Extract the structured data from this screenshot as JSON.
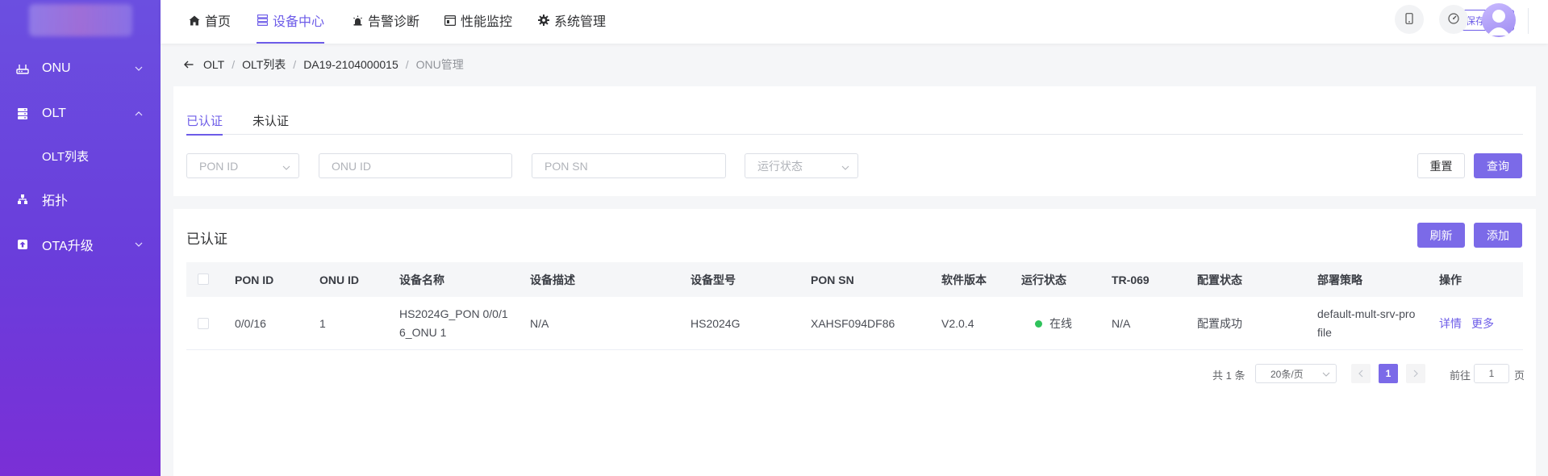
{
  "sidebar": {
    "items": [
      {
        "label": "ONU",
        "icon": "router-icon",
        "expanded": false
      },
      {
        "label": "OLT",
        "icon": "server-icon",
        "expanded": true
      },
      {
        "label": "OLT列表",
        "icon": "",
        "sub": true
      },
      {
        "label": "拓扑",
        "icon": "topology-icon"
      },
      {
        "label": "OTA升级",
        "icon": "upload-icon",
        "expanded": false
      }
    ]
  },
  "topnav": {
    "items": [
      {
        "label": "首页",
        "icon": "home-icon"
      },
      {
        "label": "设备中心",
        "icon": "device-icon",
        "active": true
      },
      {
        "label": "告警诊断",
        "icon": "alarm-icon"
      },
      {
        "label": "性能监控",
        "icon": "monitor-icon"
      },
      {
        "label": "系统管理",
        "icon": "gear-icon"
      }
    ],
    "save_config": "保存配置"
  },
  "breadcrumb": {
    "items": [
      "OLT",
      "OLT列表",
      "DA19-2104000015"
    ],
    "current": "ONU管理",
    "sep": "/"
  },
  "tabs": [
    "已认证",
    "未认证"
  ],
  "filters": {
    "pon_id_placeholder": "PON ID",
    "onu_id_placeholder": "ONU ID",
    "pon_sn_placeholder": "PON SN",
    "status_placeholder": "运行状态",
    "reset": "重置",
    "query": "查询"
  },
  "table_panel": {
    "title": "已认证",
    "refresh": "刷新",
    "add": "添加"
  },
  "table": {
    "columns": [
      "PON ID",
      "ONU ID",
      "设备名称",
      "设备描述",
      "设备型号",
      "PON SN",
      "软件版本",
      "运行状态",
      "TR-069",
      "配置状态",
      "部署策略",
      "操作"
    ],
    "rows": [
      {
        "pon_id": "0/0/16",
        "onu_id": "1",
        "name_line1": "HS2024G_PON 0/0/1",
        "name_line2": "6_ONU 1",
        "desc": "N/A",
        "model": "HS2024G",
        "pon_sn": "XAHSF094DF86",
        "version": "V2.0.4",
        "status": "在线",
        "tr069": "N/A",
        "config_status": "配置成功",
        "policy_line1": "default-mult-srv-pro",
        "policy_line2": "file",
        "op_detail": "详情",
        "op_more": "更多"
      }
    ]
  },
  "pagination": {
    "total": "共 1 条",
    "page_size": "20条/页",
    "current_page": "1",
    "goto_prefix": "前往",
    "goto_value": "1",
    "goto_suffix": "页"
  },
  "colors": {
    "accent": "#6d5ce8",
    "primary_button": "#7b6ae8",
    "online": "#2fc25b"
  }
}
